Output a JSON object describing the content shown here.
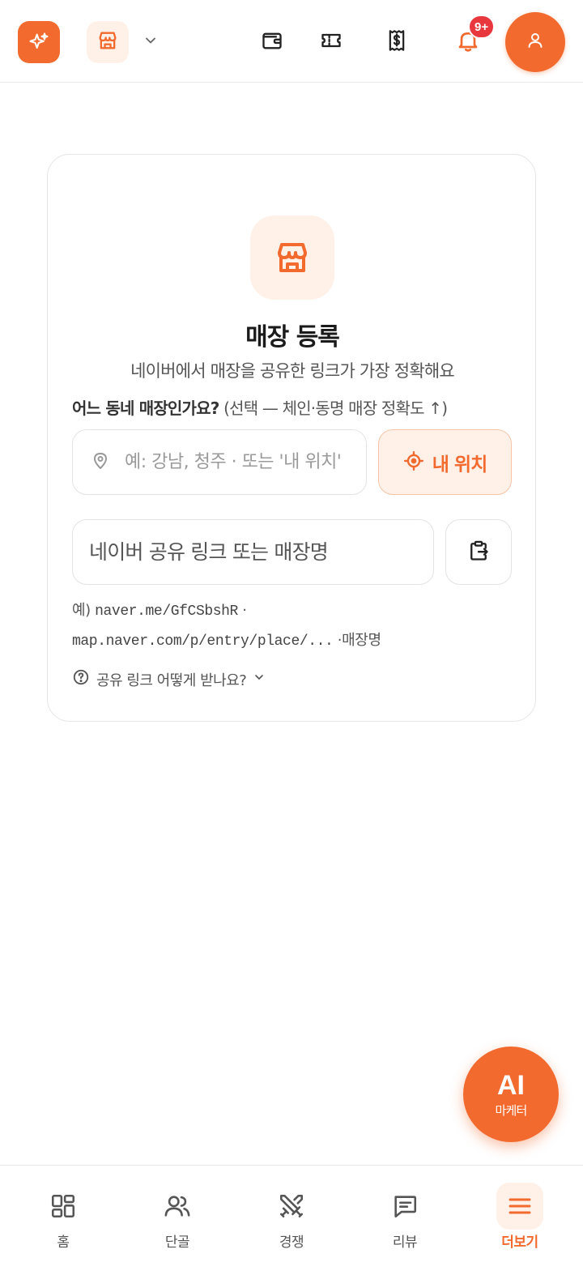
{
  "colors": {
    "accent": "#f26a2e",
    "accent_soft": "#fff1e8",
    "badge": "#e8383d"
  },
  "topbar": {
    "notification_badge": "9+",
    "icons": [
      "sparkle-icon",
      "store-icon",
      "chevron-down-icon",
      "wallet-icon",
      "ticket-icon",
      "receipt-icon",
      "bell-icon",
      "user-icon"
    ]
  },
  "card": {
    "title": "매장 등록",
    "description": "네이버에서 매장을 공유한 링크가 가장 정확해요",
    "area_label": "어느 동네 매장인가요?",
    "area_hint": "(선택 — 체인·동명 매장 정확도 ↑)",
    "area_placeholder": "예: 강남, 청주 · 또는 '내 위치'",
    "locate_label": "내 위치",
    "link_placeholder": "네이버 공유 링크 또는 매장명",
    "example_prefix": "예)",
    "example_1": "naver.me/GfCSbshR",
    "example_sep": "·",
    "example_2": "map.naver.com/p/entry/place/...",
    "example_suffix": "매장명",
    "help_label": "공유 링크 어떻게 받나요?"
  },
  "ai_fab": {
    "big": "AI",
    "small": "마케터"
  },
  "bottom_nav": {
    "items": [
      {
        "label": "홈",
        "icon": "grid-icon"
      },
      {
        "label": "단골",
        "icon": "users-icon"
      },
      {
        "label": "경쟁",
        "icon": "swords-icon"
      },
      {
        "label": "리뷰",
        "icon": "message-icon"
      },
      {
        "label": "더보기",
        "icon": "menu-icon",
        "active": true
      }
    ]
  }
}
